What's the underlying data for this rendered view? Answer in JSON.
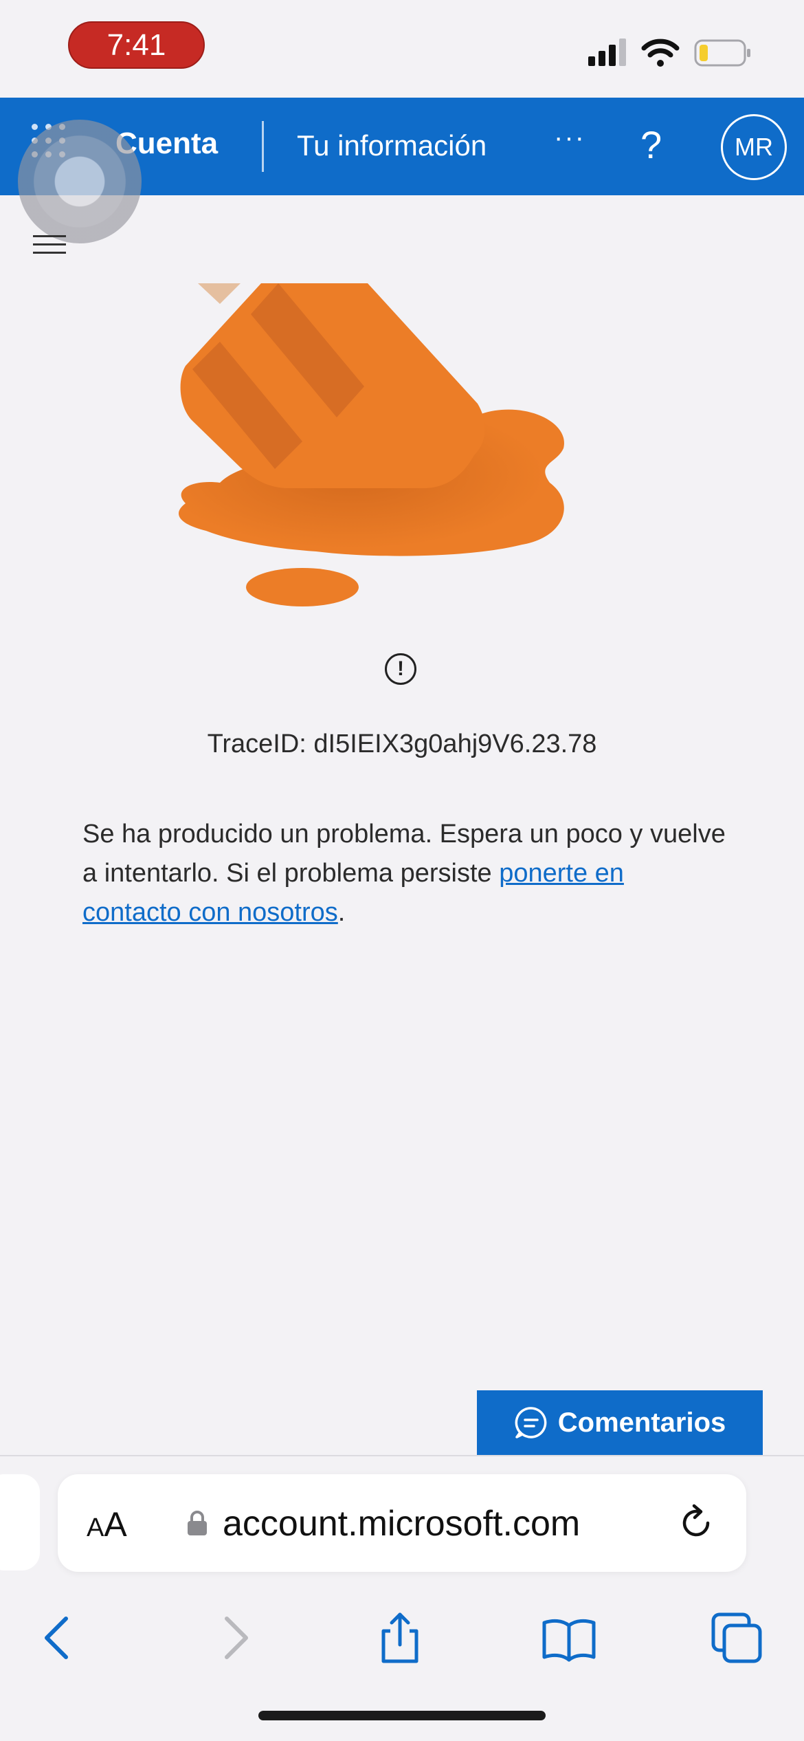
{
  "status_bar": {
    "time": "7:41"
  },
  "header": {
    "app_name": "Cuenta",
    "section": "Tu información",
    "more": "···",
    "help": "?",
    "avatar_initials": "MR"
  },
  "error": {
    "alert_symbol": "!",
    "trace_id": "TraceID: dI5IEIX3g0ahj9V6.23.78",
    "message_prefix": "Se ha producido un problema. Espera un poco y vuelve a intentarlo. Si el problema persiste ",
    "contact_link": "ponerte en contacto con nosotros",
    "message_suffix": "."
  },
  "feedback": {
    "label": "Comentarios"
  },
  "browser": {
    "text_size_label": "AA",
    "url": "account.microsoft.com"
  },
  "colors": {
    "brand_blue": "#0f6cc9",
    "illustration_orange": "#ec7d27",
    "status_time_red": "#c62a24"
  },
  "icons": [
    "apps-waffle-icon",
    "hamburger-menu-icon",
    "alert-circle-icon",
    "chat-bubble-icon",
    "lock-icon",
    "reload-icon",
    "back-arrow-icon",
    "forward-arrow-icon",
    "share-icon",
    "bookmarks-icon",
    "tabs-icon"
  ]
}
